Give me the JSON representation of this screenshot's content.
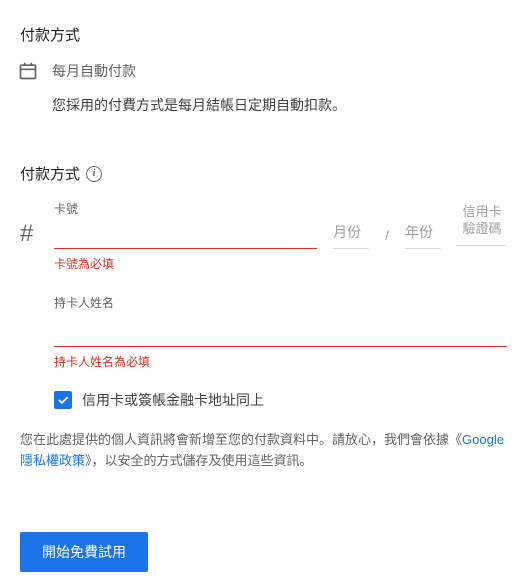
{
  "section1": {
    "title": "付款方式",
    "autoPayLabel": "每月自動付款",
    "description": "您採用的付費方式是每月結帳日定期自動扣款。"
  },
  "section2": {
    "title": "付款方式",
    "cardNumberLabel": "卡號",
    "cardNumberError": "卡號為必填",
    "monthPlaceholder": "月份",
    "yearPlaceholder": "年份",
    "slash": "/",
    "cvcLabel": "信用卡驗證碼",
    "cardholderLabel": "持卡人姓名",
    "cardholderError": "持卡人姓名為必填",
    "sameAddressLabel": "信用卡或簽帳金融卡地址同上"
  },
  "privacy": {
    "part1": "您在此處提供的個人資訊將會新增至您的付款資料中。請放心，我們會依據《",
    "link": "Google 隱私權政策",
    "part2": "》，以安全的方式儲存及使用這些資訊。"
  },
  "button": {
    "startTrial": "開始免費試用"
  }
}
